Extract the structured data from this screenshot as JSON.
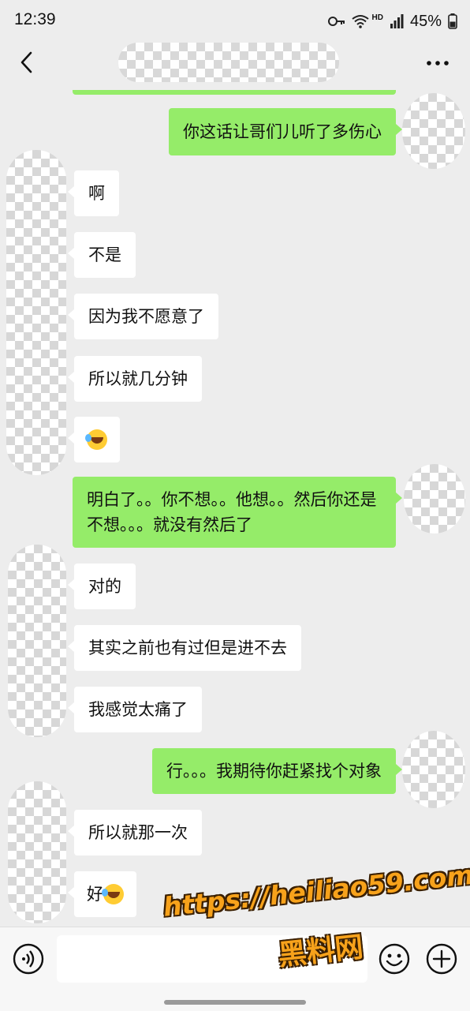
{
  "status_bar": {
    "time": "12:39",
    "network_badge": "HD",
    "battery": "45%"
  },
  "nav": {
    "back_icon": "chevron-left-icon",
    "more_icon": "more-dots-icon"
  },
  "messages": [
    {
      "side": "right",
      "text": "你这话让哥们儿听了多伤心"
    },
    {
      "side": "left",
      "text": "啊"
    },
    {
      "side": "left",
      "text": "不是"
    },
    {
      "side": "left",
      "text": "因为我不愿意了"
    },
    {
      "side": "left",
      "text": "所以就几分钟"
    },
    {
      "side": "left",
      "text": "",
      "emoji": "rolling-on-floor-laughing-icon"
    },
    {
      "side": "right",
      "text": "明白了。。你不想。。他想。。然后你还是不想。。。就没有然后了"
    },
    {
      "side": "left",
      "text": "对的"
    },
    {
      "side": "left",
      "text": "其实之前也有过但是进不去"
    },
    {
      "side": "left",
      "text": "我感觉太痛了"
    },
    {
      "side": "right",
      "text": "行。。。我期待你赶紧找个对象"
    },
    {
      "side": "left",
      "text": "所以就那一次"
    },
    {
      "side": "left",
      "text": "好",
      "emoji": "rolling-on-floor-laughing-icon"
    }
  ],
  "input_bar": {
    "voice_icon": "voice-icon",
    "emoji_icon": "smiley-icon",
    "plus_icon": "plus-icon",
    "placeholder": ""
  },
  "watermark": {
    "url": "https://heiliao59.com",
    "text": "黑料网"
  },
  "colors": {
    "background": "#ededed",
    "bubble_self": "#95ec69",
    "bubble_other": "#ffffff",
    "watermark": "#f7a21b"
  }
}
